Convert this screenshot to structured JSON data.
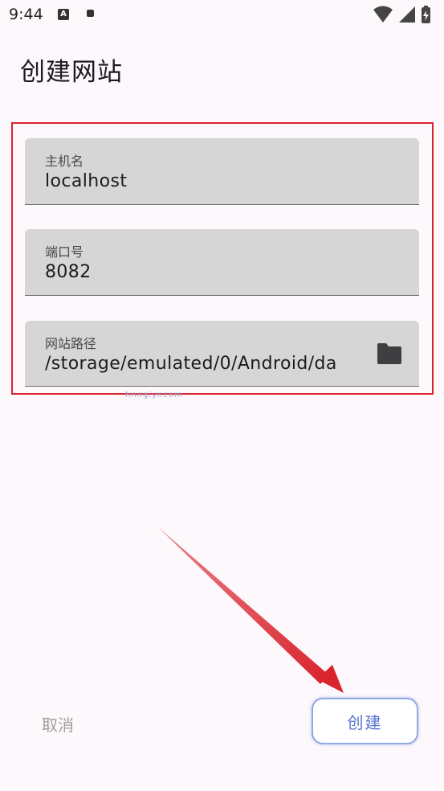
{
  "status_bar": {
    "time": "9:44",
    "notification_icons": [
      "text-a-icon",
      "square-icon"
    ],
    "system_icons": [
      "wifi-icon",
      "signal-icon",
      "battery-charging-icon"
    ]
  },
  "page": {
    "title": "创建网站"
  },
  "form": {
    "host": {
      "label": "主机名",
      "value": "localhost"
    },
    "port": {
      "label": "端口号",
      "value": "8082"
    },
    "path": {
      "label": "网站路径",
      "value": "/storage/emulated/0/Android/da",
      "action_icon": "folder-icon"
    }
  },
  "watermark": {
    "text": "hnngiyncom"
  },
  "actions": {
    "cancel_label": "取消",
    "create_label": "创建"
  },
  "colors": {
    "background": "#fdf8fc",
    "field_fill": "#d6d6d6",
    "highlight_border": "#d9232d",
    "arrow": "#d9232d",
    "create_accent": "#5876cc",
    "cancel_text": "#9e9e9e"
  }
}
